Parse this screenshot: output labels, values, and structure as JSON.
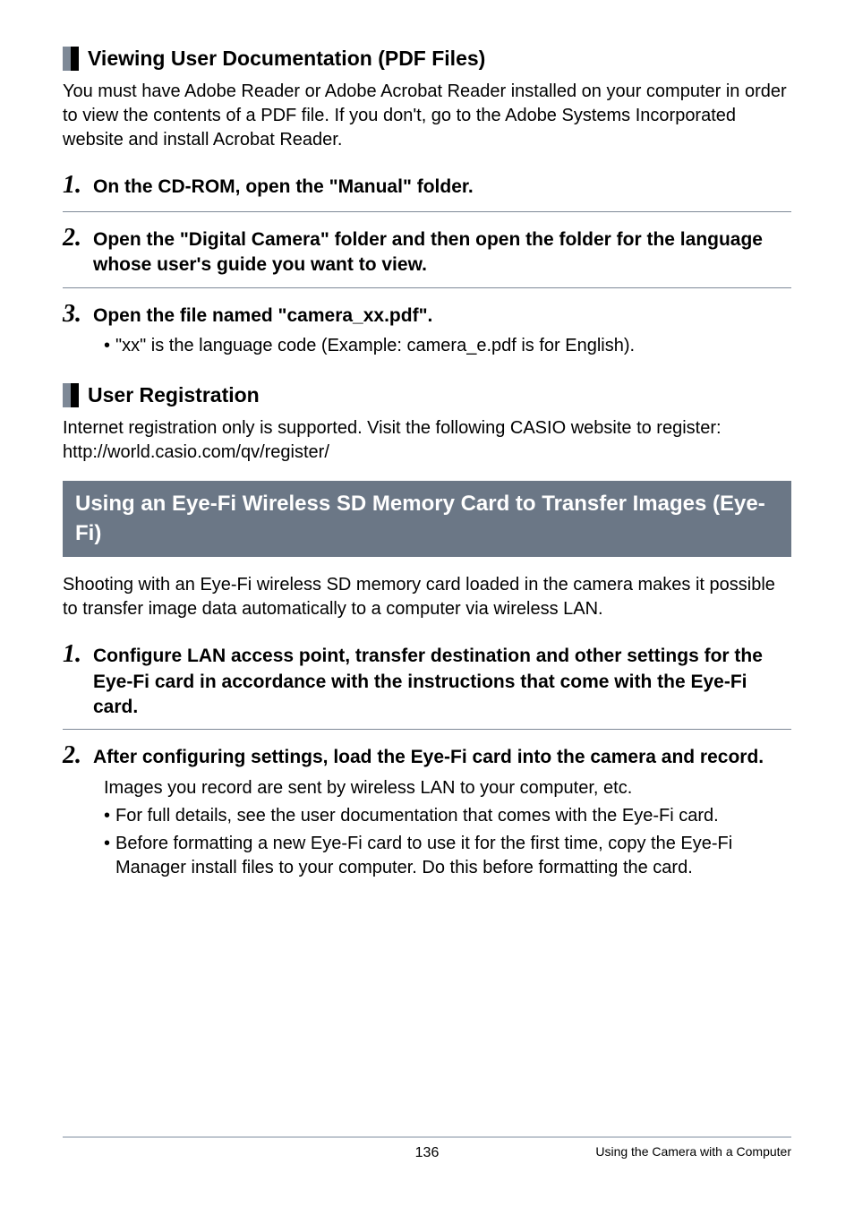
{
  "section1": {
    "title": "Viewing User Documentation (PDF Files)",
    "intro": "You must have Adobe Reader or Adobe Acrobat Reader installed on your computer in order to view the contents of a PDF file. If you don't, go to the Adobe Systems Incorporated website and install Acrobat Reader.",
    "steps": [
      {
        "num": "1.",
        "text": "On the CD-ROM, open the \"Manual\" folder."
      },
      {
        "num": "2.",
        "text": "Open the \"Digital Camera\" folder and then open the folder for the language whose user's guide you want to view."
      },
      {
        "num": "3.",
        "text": "Open the file named \"camera_xx.pdf\".",
        "bullets": [
          "\"xx\" is the language code (Example: camera_e.pdf is for English)."
        ]
      }
    ]
  },
  "section2": {
    "title": "User Registration",
    "para1": "Internet registration only is supported. Visit the following CASIO website to register:",
    "para2": "http://world.casio.com/qv/register/"
  },
  "section3": {
    "title": "Using an Eye-Fi Wireless SD Memory Card to Transfer Images (Eye-Fi)",
    "intro": "Shooting with an Eye-Fi wireless SD memory card loaded in the camera makes it possible to transfer image data automatically to a computer via wireless LAN.",
    "steps": [
      {
        "num": "1.",
        "text": "Configure LAN access point, transfer destination and other settings for the Eye-Fi card in accordance with the instructions that come with the Eye-Fi card."
      },
      {
        "num": "2.",
        "text": "After configuring settings, load the Eye-Fi card into the camera and record.",
        "after": "Images you record are sent by wireless LAN to your computer, etc.",
        "bullets": [
          "For full details, see the user documentation that comes with the Eye-Fi card.",
          "Before formatting a new Eye-Fi card to use it for the first time, copy the Eye-Fi Manager install files to your computer. Do this before formatting the card."
        ]
      }
    ]
  },
  "footer": {
    "page": "136",
    "section": "Using the Camera with a Computer"
  }
}
